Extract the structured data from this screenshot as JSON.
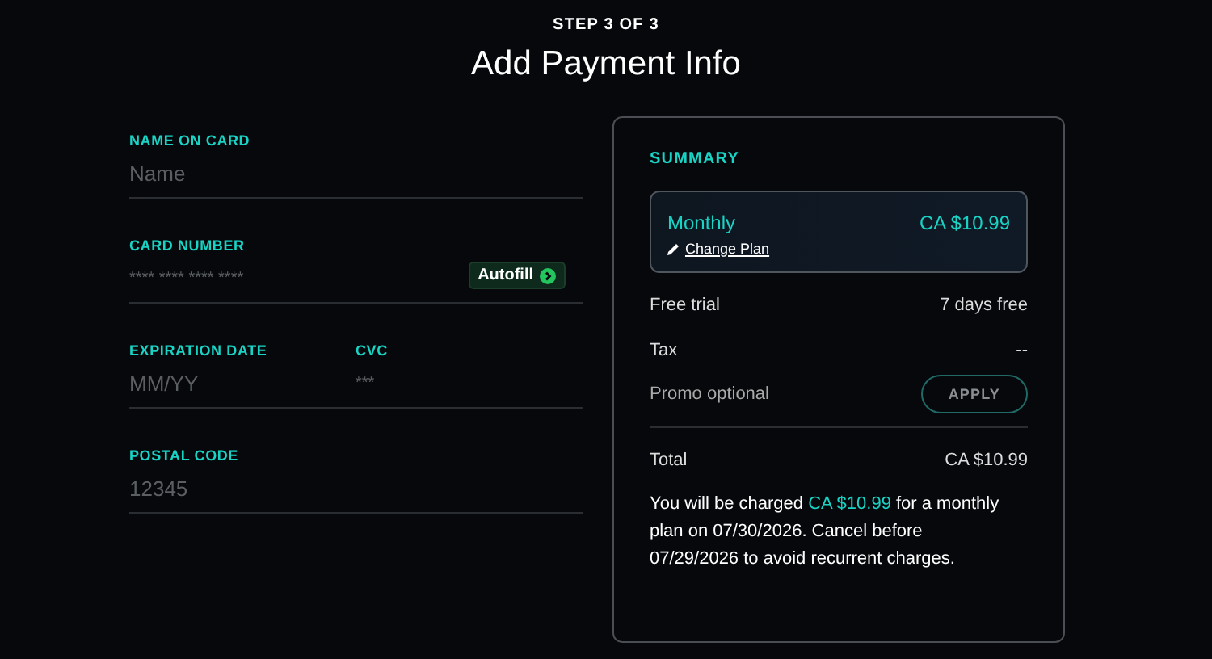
{
  "header": {
    "step": "STEP 3 OF 3",
    "title": "Add Payment Info"
  },
  "form": {
    "rows": [
      {
        "fields": [
          {
            "label": "NAME ON CARD",
            "placeholder": "Name",
            "kind": "text"
          }
        ]
      },
      {
        "fields": [
          {
            "label": "CARD NUMBER",
            "placeholder": "**** **** **** ****",
            "kind": "masked"
          }
        ],
        "autofill": "Autofill"
      },
      {
        "fields": [
          {
            "label": "EXPIRATION DATE",
            "placeholder": "MM/YY",
            "kind": "text"
          },
          {
            "label": "CVC",
            "placeholder": "***",
            "kind": "masked"
          }
        ]
      },
      {
        "fields": [
          {
            "label": "POSTAL CODE",
            "placeholder": "12345",
            "kind": "text"
          }
        ]
      }
    ]
  },
  "summary": {
    "heading": "SUMMARY",
    "plan": {
      "name": "Monthly",
      "price": "CA $10.99",
      "change": "Change Plan"
    },
    "lines": [
      {
        "label": "Free trial",
        "value": "7 days free"
      },
      {
        "label": "Tax",
        "value": "--"
      }
    ],
    "promo": {
      "placeholder": "Promo optional",
      "button": "APPLY"
    },
    "total": {
      "label": "Total",
      "value": "CA $10.99"
    },
    "notice": {
      "before": "You will be charged ",
      "amount": "CA $10.99",
      "after": " for a monthly plan on 07/30/2026. Cancel before 07/29/2026 to avoid recurrent charges."
    }
  }
}
